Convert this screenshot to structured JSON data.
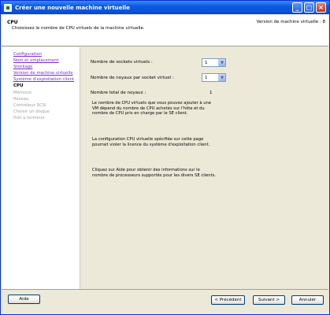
{
  "window": {
    "title": "Créer une nouvelle machine virtuelle",
    "minimize": "_",
    "maximize": "□",
    "close": "×"
  },
  "header": {
    "title": "CPU",
    "subtitle": "Choisissez le nombre de CPU virtuels de la machine virtuelle.",
    "version": "Version de machine virtuelle : 8"
  },
  "sidebar": {
    "items": [
      {
        "label": "Configuration",
        "state": "link"
      },
      {
        "label": "Nom et emplacement",
        "state": "link"
      },
      {
        "label": "Stockage",
        "state": "link"
      },
      {
        "label": "Version de machine virtuelle",
        "state": "link"
      },
      {
        "label": "Système d'exploitation client",
        "state": "link"
      },
      {
        "label": "CPU",
        "state": "current"
      },
      {
        "label": "Mémoire",
        "state": "disabled"
      },
      {
        "label": "Réseau",
        "state": "disabled"
      },
      {
        "label": "Contrôleur SCSI",
        "state": "disabled"
      },
      {
        "label": "Choisir un disque",
        "state": "disabled"
      },
      {
        "label": "Prêt à terminer",
        "state": "disabled"
      }
    ]
  },
  "form": {
    "sockets_label": "Nombre de sockets virtuels :",
    "sockets_value": "1",
    "cores_label": "Nombre de noyaux par socket virtuel :",
    "cores_value": "1",
    "total_label": "Nombre total de noyaux :",
    "total_value": "1",
    "arrow": "▼"
  },
  "info": {
    "p1": "Le nombre de CPU virtuels que vous pouvez ajouter à une VM dépend du nombre de CPU achetés sur l'hôte et du nombre de CPU pris en charge par le SE client.",
    "p2": "La configuration CPU virtuelle spécifiée sur cette page pourrait violer la licence du système d'exploitation client.",
    "p3": "Cliquez sur Aide pour obtenir des informations sur le nombre de processeurs supportés pour les divers SE clients."
  },
  "footer": {
    "help": "Aide",
    "back": "< Précédent",
    "next": "Suivant >",
    "cancel": "Annuler"
  }
}
